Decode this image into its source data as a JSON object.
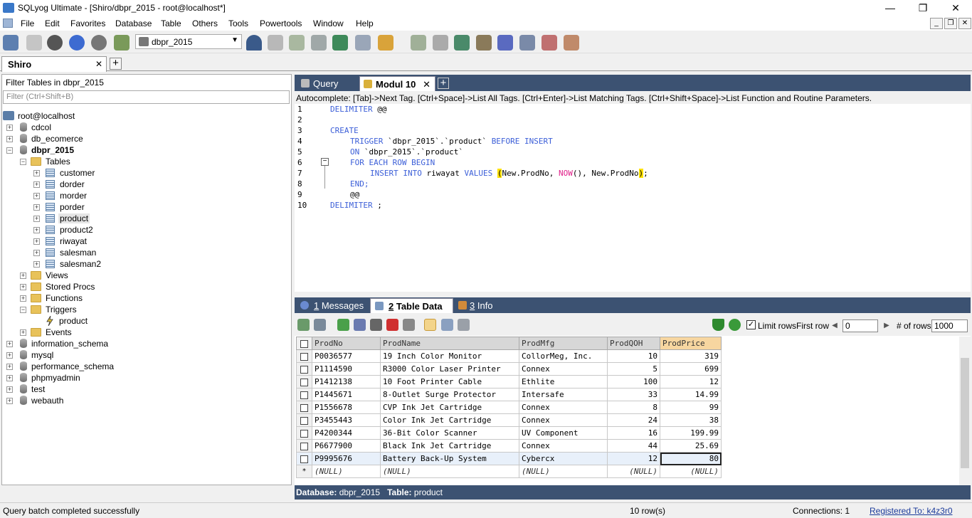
{
  "window": {
    "title": "SQLyog Ultimate - [Shiro/dbpr_2015 - root@localhost*]",
    "controls": {
      "minimize": "—",
      "restore": "❐",
      "close": "✕"
    }
  },
  "menu": {
    "items": [
      "File",
      "Edit",
      "Favorites",
      "Database",
      "Table",
      "Others",
      "Tools",
      "Powertools",
      "Window",
      "Help"
    ],
    "mdi": {
      "minimize": "_",
      "restore": "❐",
      "close": "✕"
    }
  },
  "toolbar": {
    "database_select": "dbpr_2015",
    "dropdown_arrow": "▼"
  },
  "connection_tab": {
    "label": "Shiro",
    "close": "✕",
    "add": "+"
  },
  "object_browser": {
    "filter_title": "Filter Tables in dbpr_2015",
    "filter_placeholder": "Filter (Ctrl+Shift+B)",
    "root": "root@localhost",
    "databases": [
      "cdcol",
      "db_ecomerce",
      "dbpr_2015"
    ],
    "open_db": {
      "tables_label": "Tables",
      "tables": [
        "customer",
        "dorder",
        "morder",
        "porder",
        "product",
        "product2",
        "riwayat",
        "salesman",
        "salesman2"
      ],
      "views": "Views",
      "procs": "Stored Procs",
      "functions": "Functions",
      "triggers": "Triggers",
      "trigger_items": [
        "product"
      ],
      "events": "Events"
    },
    "other_dbs": [
      "information_schema",
      "mysql",
      "performance_schema",
      "phpmyadmin",
      "test",
      "webauth"
    ],
    "expand_plus": "+",
    "expand_minus": "−"
  },
  "editor_tabs": {
    "query": "Query",
    "modul": "Modul 10",
    "close": "✕",
    "add": "+"
  },
  "autocomplete": "Autocomplete: [Tab]->Next Tag. [Ctrl+Space]->List All Tags. [Ctrl+Enter]->List Matching Tags. [Ctrl+Shift+Space]->List Function and Routine Parameters.",
  "code": {
    "line_numbers": [
      "1",
      "2",
      "3",
      "4",
      "5",
      "6",
      "7",
      "8",
      "9",
      "10"
    ],
    "l1_kw": "DELIMITER",
    "l1_rest": " @@",
    "l3": "CREATE",
    "l4_kw": "TRIGGER",
    "l4_mid": " `dbpr_2015`.`product` ",
    "l4_kw2": "BEFORE INSERT",
    "l5_kw": "ON",
    "l5_rest": " `dbpr_2015`.`product`",
    "l6": "FOR EACH ROW BEGIN",
    "l7_kw": "INSERT INTO",
    "l7_a": " riwayat ",
    "l7_kw2": "VALUES",
    "l7_sp": " ",
    "l7_p1": "(",
    "l7_b": "New.ProdNo, ",
    "l7_fn": "NOW",
    "l7_c": "(), New.ProdNo",
    "l7_p2": ")",
    "l7_end": ";",
    "l8": "END;",
    "l9": "@@",
    "l10_kw": "DELIMITER",
    "l10_rest": " ;",
    "fold": "−"
  },
  "result_tabs": {
    "messages_num": "1",
    "messages": " Messages",
    "tabledata_num": "2",
    "tabledata": " Table Data",
    "info_num": "3",
    "info": " Info"
  },
  "result_toolbar": {
    "limit_rows": "Limit rows",
    "checked": "✓",
    "first_row": "First row",
    "first_row_value": "0",
    "num_rows": "# of rows",
    "num_rows_value": "1000",
    "prev": "◀",
    "next": "▶"
  },
  "grid": {
    "columns": [
      "ProdNo",
      "ProdName",
      "ProdMfg",
      "ProdQOH",
      "ProdPrice"
    ],
    "rows": [
      [
        "P0036577",
        "19 Inch Color Monitor",
        "CollorMeg, Inc.",
        "10",
        "319"
      ],
      [
        "P1114590",
        "R3000 Color Laser Printer",
        "Connex",
        "5",
        "699"
      ],
      [
        "P1412138",
        "10 Foot Printer Cable",
        "Ethlite",
        "100",
        "12"
      ],
      [
        "P1445671",
        "8-Outlet Surge Protector",
        "Intersafe",
        "33",
        "14.99"
      ],
      [
        "P1556678",
        "CVP Ink Jet Cartridge",
        "Connex",
        "8",
        "99"
      ],
      [
        "P3455443",
        "Color Ink Jet Cartridge",
        "Connex",
        "24",
        "38"
      ],
      [
        "P4200344",
        "36-Bit Color Scanner",
        "UV Component",
        "16",
        "199.99"
      ],
      [
        "P6677900",
        "Black Ink Jet Cartridge",
        "Connex",
        "44",
        "25.69"
      ],
      [
        "P9995676",
        "Battery Back-Up System",
        "Cybercx",
        "12",
        "80"
      ]
    ],
    "new_row_marker": "*",
    "null": "(NULL)"
  },
  "infobar": {
    "db_label": "Database:",
    "db": " dbpr_2015",
    "table_label": "Table:",
    "table": " product"
  },
  "status": {
    "message": "Query batch completed successfully",
    "rows": "10 row(s)",
    "connections": "Connections: 1",
    "registered": "Registered To: k4z3r0"
  }
}
